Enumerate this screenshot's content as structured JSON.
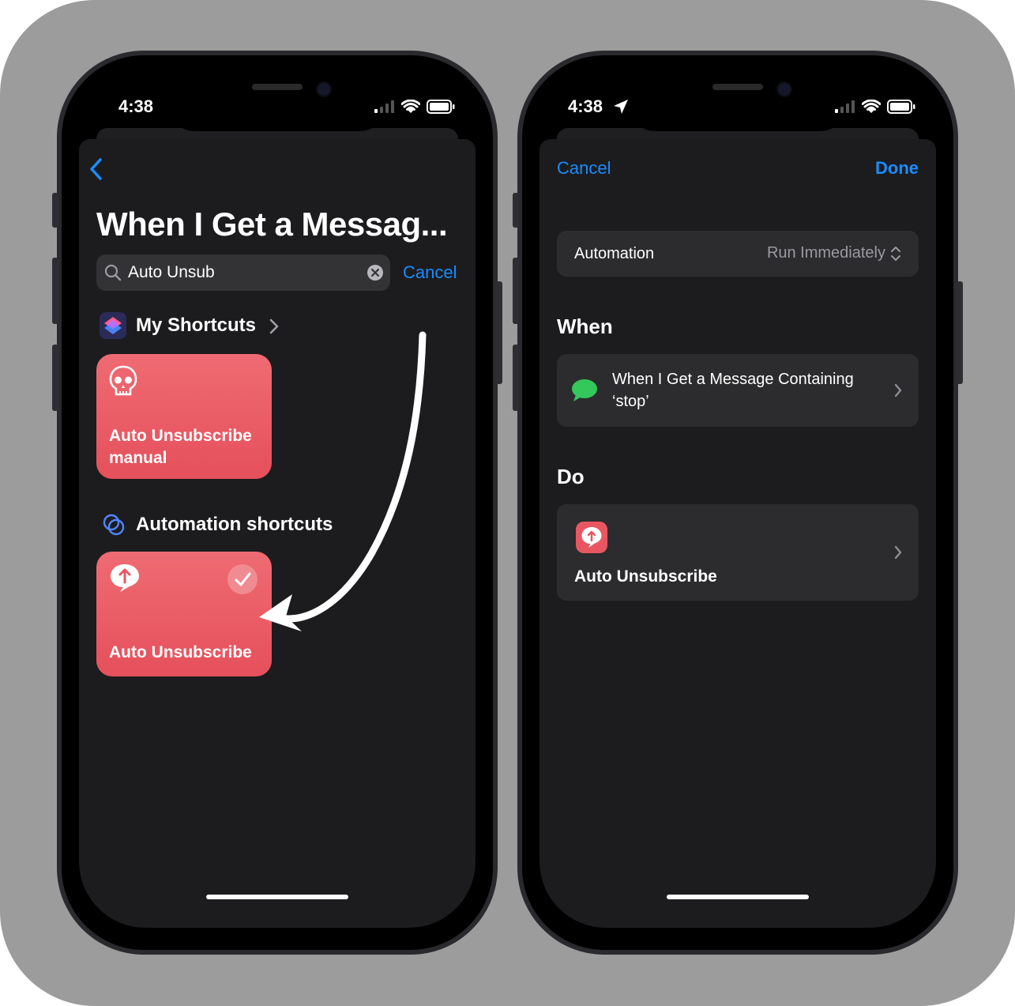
{
  "left": {
    "status_time": "4:38",
    "title": "When I Get a Messag...",
    "search": {
      "value": "Auto Unsub",
      "cancel": "Cancel"
    },
    "my_shortcuts": {
      "label": "My Shortcuts"
    },
    "card_manual": {
      "line1": "Auto Unsubscribe",
      "line2": "manual"
    },
    "automation_shortcuts": {
      "label": "Automation shortcuts"
    },
    "card_auto": {
      "label": "Auto Unsubscribe"
    }
  },
  "right": {
    "status_time": "4:38",
    "cancel": "Cancel",
    "done": "Done",
    "automation_row": {
      "label": "Automation",
      "value": "Run Immediately"
    },
    "when_header": "When",
    "when_row": {
      "line1": "When I Get a Message Containing",
      "line2": "‘stop’"
    },
    "do_header": "Do",
    "do_row": {
      "label": "Auto Unsubscribe"
    }
  },
  "colors": {
    "accent_blue": "#1a8cff",
    "card_red": "#e85761",
    "message_green": "#34c759",
    "screen_bg": "#1c1c1e",
    "row_bg": "#2c2c2e"
  },
  "icons": [
    "back-chevron-icon",
    "search-icon",
    "clear-icon",
    "shortcuts-app-icon",
    "chevron-right-icon",
    "skull-icon",
    "automation-icon",
    "upload-bubble-icon",
    "checkmark-icon",
    "arrow-annotation",
    "location-arrow-icon",
    "signal-icon",
    "wifi-icon",
    "battery-icon",
    "messages-icon",
    "up-down-chevron-icon"
  ]
}
